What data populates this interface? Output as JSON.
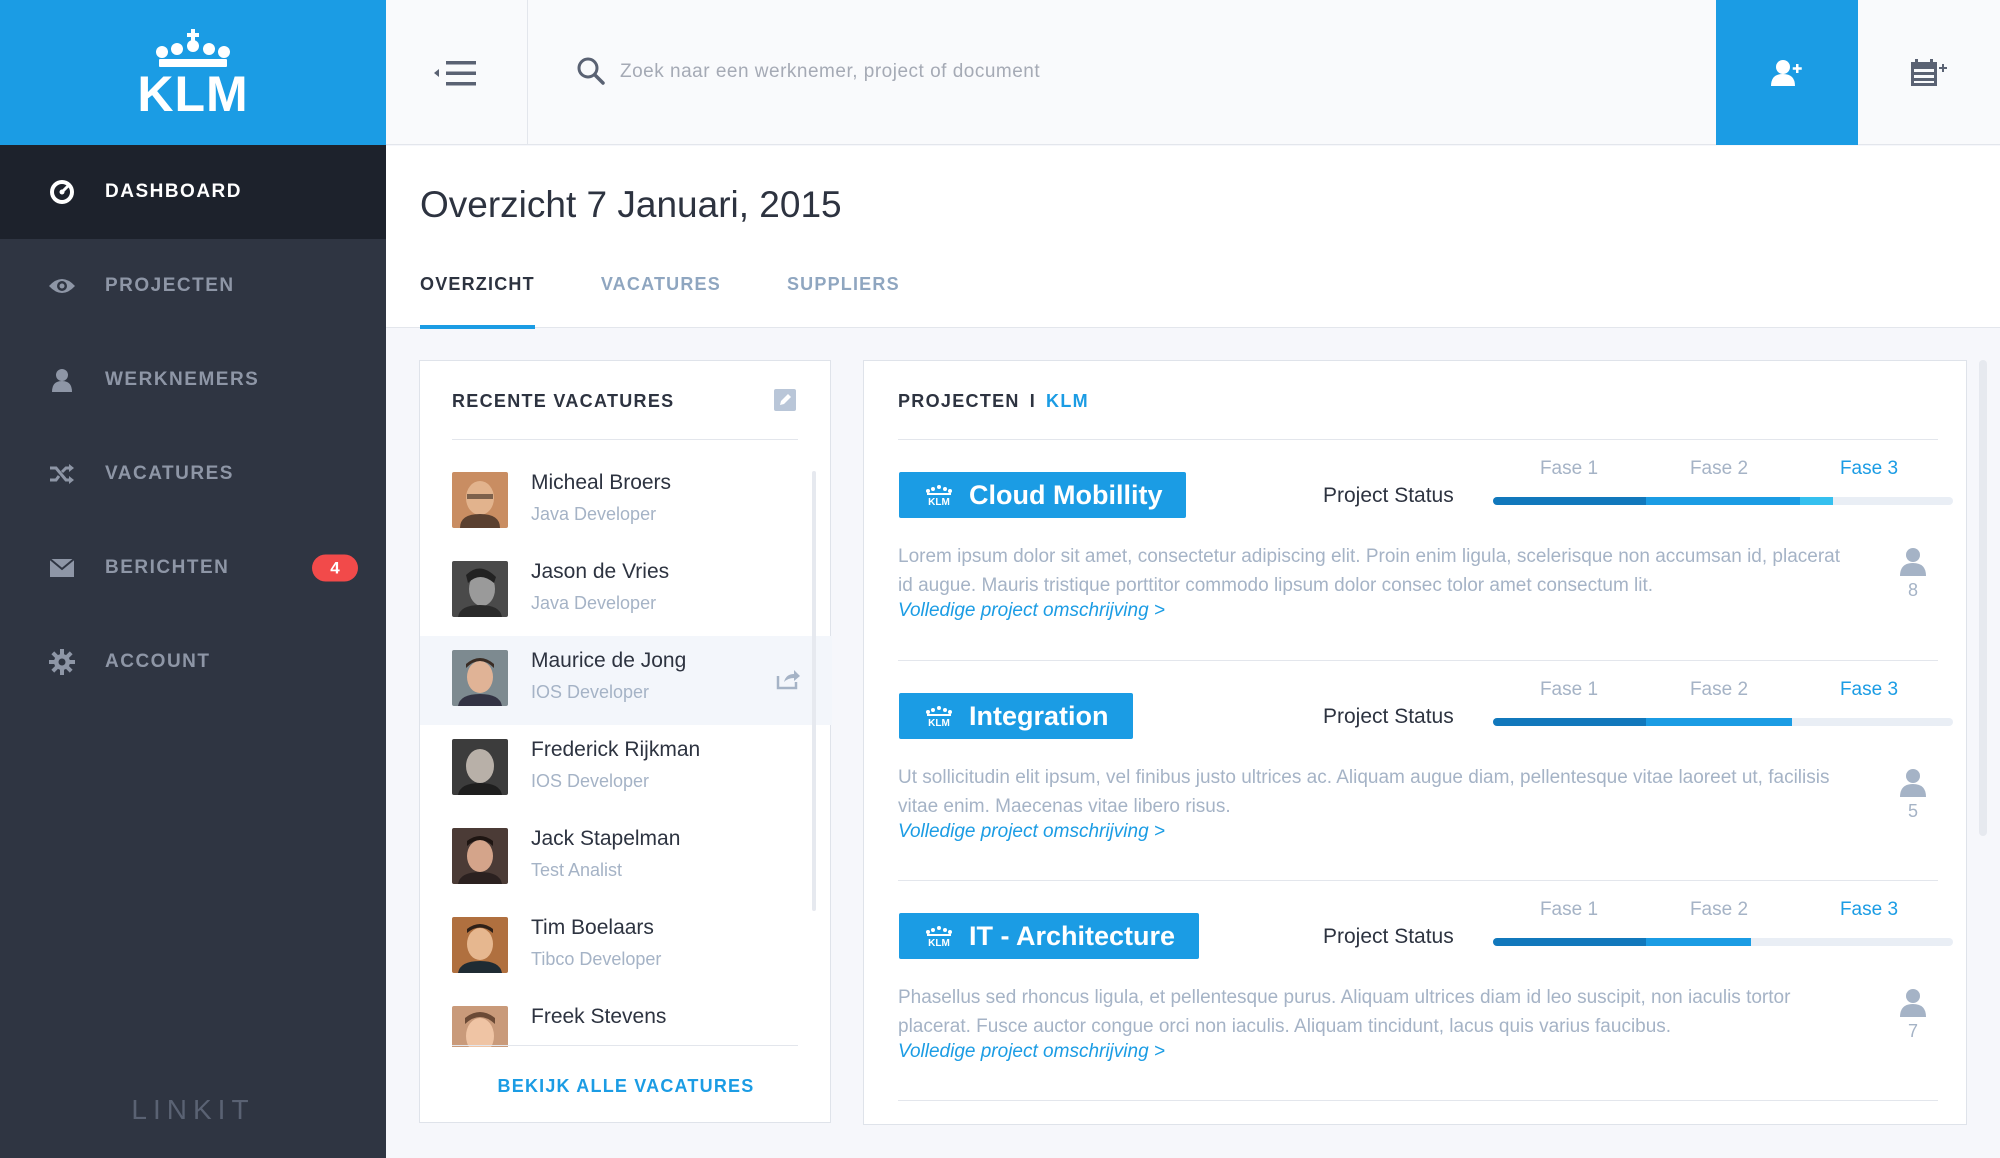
{
  "brand": {
    "logo_text": "KLM",
    "footer": "LINKIT",
    "accent": "#1b9ce4"
  },
  "sidebar": {
    "items": [
      {
        "label": "DASHBOARD",
        "icon": "gauge-icon",
        "active": true
      },
      {
        "label": "PROJECTEN",
        "icon": "eye-icon"
      },
      {
        "label": "WERKNEMERS",
        "icon": "person-icon"
      },
      {
        "label": "VACATURES",
        "icon": "shuffle-icon"
      },
      {
        "label": "BERICHTEN",
        "icon": "envelope-icon",
        "badge": "4"
      },
      {
        "label": "ACCOUNT",
        "icon": "gear-icon"
      }
    ]
  },
  "topbar": {
    "search_placeholder": "Zoek naar een werknemer, project of document"
  },
  "page": {
    "title": "Overzicht 7 Januari, 2015",
    "tabs": [
      {
        "label": "OVERZICHT",
        "active": true
      },
      {
        "label": "VACATURES"
      },
      {
        "label": "SUPPLIERS"
      }
    ]
  },
  "vacatures": {
    "title": "RECENTE VACATURES",
    "items": [
      {
        "name": "Micheal Broers",
        "role": "Java Developer"
      },
      {
        "name": "Jason de Vries",
        "role": "Java Developer"
      },
      {
        "name": "Maurice de Jong",
        "role": "IOS Developer"
      },
      {
        "name": "Frederick Rijkman",
        "role": "IOS Developer"
      },
      {
        "name": "Jack Stapelman",
        "role": "Test Analist"
      },
      {
        "name": "Tim Boelaars",
        "role": "Tibco Developer"
      },
      {
        "name": "Freek Stevens",
        "role": ""
      }
    ],
    "view_all": "BEKIJK ALLE VACATURES"
  },
  "projects": {
    "heading": "PROJECTEN",
    "separator": "I",
    "org": "KLM",
    "status_label": "Project Status",
    "phases": [
      "Fase 1",
      "Fase 2",
      "Fase 3"
    ],
    "link_text": "Volledige project omschrijving >",
    "items": [
      {
        "name": "Cloud Mobillity",
        "progress": 0.74,
        "members": "8",
        "description": "Lorem ipsum dolor sit amet, consectetur adipiscing elit. Proin enim ligula, scelerisque non accumsan id, placerat id augue. Mauris tristique porttitor commodo lipsum dolor consec tolor amet consectum lit."
      },
      {
        "name": "Integration",
        "progress": 0.65,
        "members": "5",
        "description": "Ut sollicitudin elit ipsum, vel finibus justo ultrices ac. Aliquam augue diam, pellentesque vitae laoreet ut, facilisis vitae enim. Maecenas vitae libero risus."
      },
      {
        "name": "IT - Architecture",
        "progress": 0.56,
        "members": "7",
        "description": "Phasellus sed rhoncus ligula, et pellentesque purus. Aliquam ultrices diam id leo suscipit, non iaculis tortor placerat. Fusce auctor congue orci non iaculis. Aliquam tincidunt, lacus quis varius faucibus."
      }
    ]
  }
}
